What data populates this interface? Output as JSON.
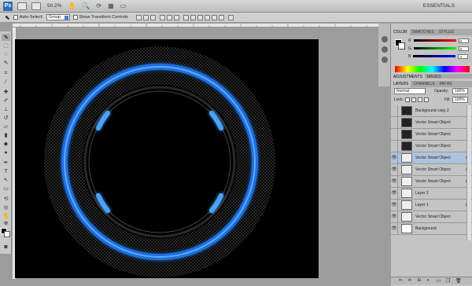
{
  "appbar": {
    "logo": "Ps",
    "zoom": "50.2%",
    "workspace": "ESSENTIALS"
  },
  "options": {
    "auto_select": "Auto-Select:",
    "group_value": "Group",
    "show_transform": "Show Transform Controls"
  },
  "panels": {
    "color_tabs": [
      "COLOR",
      "SWATCHES",
      "STYLES"
    ],
    "sliders": [
      {
        "label": "R",
        "value": "0"
      },
      {
        "label": "G",
        "value": "0"
      },
      {
        "label": "B",
        "value": "0"
      }
    ],
    "adj_tabs": [
      "ADJUSTMENTS",
      "MASKS"
    ],
    "layer_tabs": [
      "LAYERS",
      "CHANNELS",
      "PATHS"
    ],
    "blend_mode": "Normal",
    "opacity_label": "Opacity:",
    "opacity_value": "100%",
    "lock_label": "Lock:",
    "fill_label": "Fill:",
    "fill_value": "100%"
  },
  "layers": [
    {
      "name": "Background copy 2",
      "visible": false,
      "fx": false,
      "selected": false
    },
    {
      "name": "Vector Smart Object",
      "visible": false,
      "fx": false,
      "selected": false
    },
    {
      "name": "Vector Smart Object",
      "visible": false,
      "fx": false,
      "selected": false
    },
    {
      "name": "Vector Smart Object",
      "visible": false,
      "fx": false,
      "selected": false
    },
    {
      "name": "Vector Smart Object",
      "visible": true,
      "fx": true,
      "selected": true
    },
    {
      "name": "Vector Smart Object",
      "visible": true,
      "fx": true,
      "selected": false
    },
    {
      "name": "Vector Smart Object",
      "visible": true,
      "fx": true,
      "selected": false
    },
    {
      "name": "Layer 2",
      "visible": true,
      "fx": false,
      "selected": false
    },
    {
      "name": "Layer 1",
      "visible": true,
      "fx": true,
      "selected": false
    },
    {
      "name": "Vector Smart Object",
      "visible": true,
      "fx": false,
      "selected": false
    },
    {
      "name": "Background",
      "visible": true,
      "fx": false,
      "selected": false
    }
  ],
  "fx_label": "fx",
  "colors": {
    "glow": "#3a8cff",
    "glow_light": "#7fc0ff",
    "selection": "#adc3e0"
  }
}
